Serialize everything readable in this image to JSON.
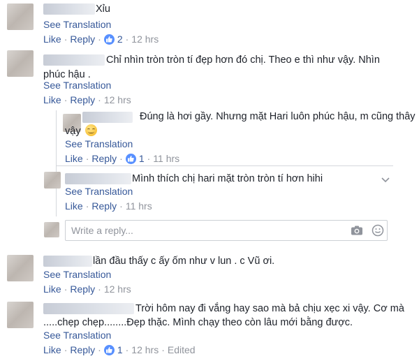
{
  "comments": [
    {
      "text": "Xỉu",
      "see_translation": "See Translation",
      "like": "Like",
      "reply": "Reply",
      "like_count": "2",
      "time": "12 hrs"
    },
    {
      "text_line1": "Chỉ nhìn tròn tròn tí đẹp hơn đó chị. Theo e thì như vậy. Nhìn",
      "text_line2": "phúc hậu .",
      "see_translation": "See Translation",
      "like": "Like",
      "reply": "Reply",
      "time": "12 hrs"
    },
    {
      "text_line1": "Đúng là hơi gầy. Nhưng mặt Hari luôn phúc hậu, m cũng thây",
      "text_line2": "vậy",
      "emoji": "smiling-face-icon",
      "see_translation": "See Translation",
      "like": "Like",
      "reply": "Reply",
      "like_count": "1",
      "time": "11 hrs"
    },
    {
      "text": "Mình thích chị hari mặt tròn tròn tí hơn hihi",
      "see_translation": "See Translation",
      "like": "Like",
      "reply": "Reply",
      "time": "11 hrs"
    },
    {
      "text": "lần đầu thấy c ấy ốm như v lun . c Vũ ơi.",
      "see_translation": "See Translation",
      "like": "Like",
      "reply": "Reply",
      "time": "12 hrs"
    },
    {
      "text_line1": "Trời hôm nay đi vắng hay sao mà bả chịu xẹc xi vậy. Cơ mà",
      "text_line2": ".....chẹp chẹp........Đẹp thặc. Mình chạy theo còn lâu mới bằng được.",
      "see_translation": "See Translation",
      "like": "Like",
      "reply": "Reply",
      "like_count": "1",
      "time": "12 hrs",
      "edited": "Edited"
    }
  ],
  "reply_box": {
    "placeholder": "Write a reply..."
  },
  "separator": "·",
  "colors": {
    "link": "#365899",
    "meta": "#90949c",
    "like_badge": "#5890ff"
  }
}
